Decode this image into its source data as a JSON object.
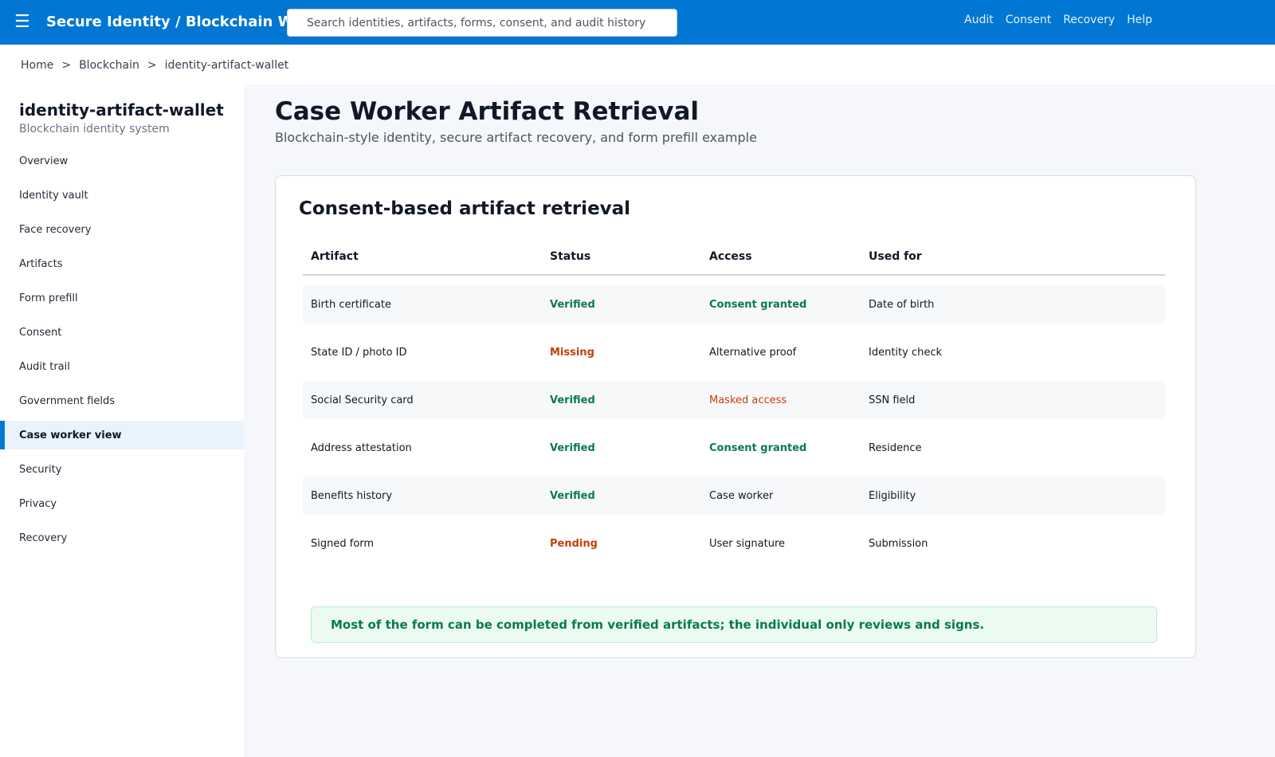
{
  "app": {
    "menu_icon": "☰",
    "title": "Secure Identity / Blockchain Wallet"
  },
  "search": {
    "placeholder": "Search identities, artifacts, forms, consent, and audit history"
  },
  "topnav": {
    "items": [
      {
        "label": "Audit"
      },
      {
        "label": "Consent"
      },
      {
        "label": "Recovery"
      },
      {
        "label": "Help"
      }
    ]
  },
  "breadcrumb": {
    "items": [
      {
        "label": "Home"
      },
      {
        "label": "Blockchain"
      },
      {
        "label": "identity-artifact-wallet"
      }
    ],
    "separator": ">"
  },
  "sidebar": {
    "title": "identity-artifact-wallet",
    "subtitle": "Blockchain identity system",
    "items": [
      {
        "label": "Overview"
      },
      {
        "label": "Identity vault"
      },
      {
        "label": "Face recovery"
      },
      {
        "label": "Artifacts"
      },
      {
        "label": "Form prefill"
      },
      {
        "label": "Consent"
      },
      {
        "label": "Audit trail"
      },
      {
        "label": "Government fields"
      },
      {
        "label": "Case worker view",
        "active": true
      },
      {
        "label": "Security"
      },
      {
        "label": "Privacy"
      },
      {
        "label": "Recovery"
      }
    ]
  },
  "page": {
    "title": "Case Worker Artifact Retrieval",
    "subtitle": "Blockchain-style identity, secure artifact recovery, and form prefill example"
  },
  "card": {
    "title": "Consent-based artifact retrieval",
    "columns": [
      "Artifact",
      "Status",
      "Access",
      "Used for"
    ],
    "rows": [
      {
        "artifact": "Birth certificate",
        "status": "Verified",
        "access": "Consent granted",
        "used_for": "Date of birth"
      },
      {
        "artifact": "State ID / photo ID",
        "status": "Missing",
        "access": "Alternative proof",
        "used_for": "Identity check"
      },
      {
        "artifact": "Social Security card",
        "status": "Verified",
        "access": "Masked access",
        "used_for": "SSN field"
      },
      {
        "artifact": "Address attestation",
        "status": "Verified",
        "access": "Consent granted",
        "used_for": "Residence"
      },
      {
        "artifact": "Benefits history",
        "status": "Verified",
        "access": "Case worker",
        "used_for": "Eligibility"
      },
      {
        "artifact": "Signed form",
        "status": "Pending",
        "access": "User signature",
        "used_for": "Submission"
      }
    ],
    "notice": "Most of the form can be completed from verified artifacts; the individual only reviews and signs."
  },
  "colors": {
    "brand": "#0176d3",
    "success": "#0a7a4f",
    "warning": "#c2410c",
    "notice_bg": "#ebfbf2"
  }
}
